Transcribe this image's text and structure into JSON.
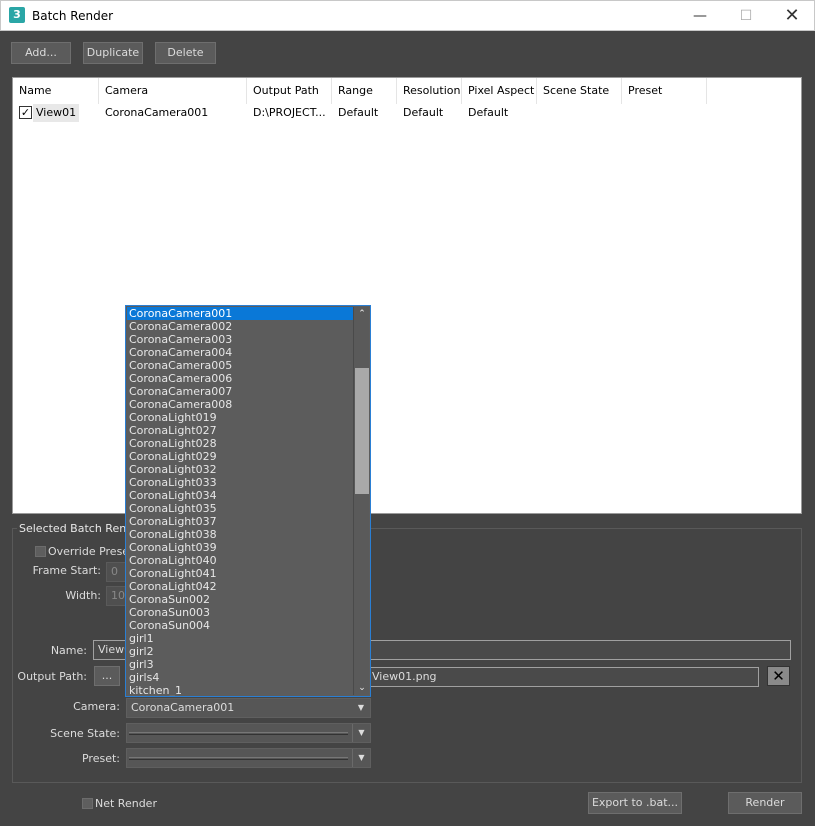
{
  "window": {
    "title": "Batch Render",
    "icon_label": "3",
    "minimize": "—",
    "maximize": "☐",
    "close": "✕"
  },
  "toolbar": {
    "add": "Add...",
    "duplicate": "Duplicate",
    "delete": "Delete"
  },
  "table": {
    "headers": [
      "Name",
      "Camera",
      "Output Path",
      "Range",
      "Resolution",
      "Pixel Aspect",
      "Scene State",
      "Preset"
    ],
    "rows": [
      {
        "checked": "✓",
        "name": "View01",
        "camera": "CoronaCamera001",
        "output": "D:\\PROJECT...",
        "range": "Default",
        "resolution": "Default",
        "aspect": "Default"
      }
    ]
  },
  "group": {
    "title": "Selected Batch Render",
    "override_preset": "Override Preset",
    "frame_start": "Frame Start:",
    "frame_start_value": "0",
    "width": "Width:",
    "width_value": "100",
    "name_label": "Name:",
    "name_value": "View0",
    "output_label": "Output Path:",
    "output_browse": "...",
    "output_value": "View01.png",
    "output_clear": "✕",
    "camera_label": "Camera:",
    "camera_value": "CoronaCamera001",
    "scene_state_label": "Scene State:",
    "preset_label": "Preset:"
  },
  "dropdown": {
    "items": [
      "CoronaCamera001",
      "CoronaCamera002",
      "CoronaCamera003",
      "CoronaCamera004",
      "CoronaCamera005",
      "CoronaCamera006",
      "CoronaCamera007",
      "CoronaCamera008",
      "CoronaLight019",
      "CoronaLight027",
      "CoronaLight028",
      "CoronaLight029",
      "CoronaLight032",
      "CoronaLight033",
      "CoronaLight034",
      "CoronaLight035",
      "CoronaLight037",
      "CoronaLight038",
      "CoronaLight039",
      "CoronaLight040",
      "CoronaLight041",
      "CoronaLight042",
      "CoronaSun002",
      "CoronaSun003",
      "CoronaSun004",
      "girl1",
      "girl2",
      "girl3",
      "girls4",
      "kitchen_1"
    ],
    "scroll_position": 0.13
  },
  "footer": {
    "net_render": "Net Render",
    "export": "Export to .bat...",
    "render": "Render"
  }
}
